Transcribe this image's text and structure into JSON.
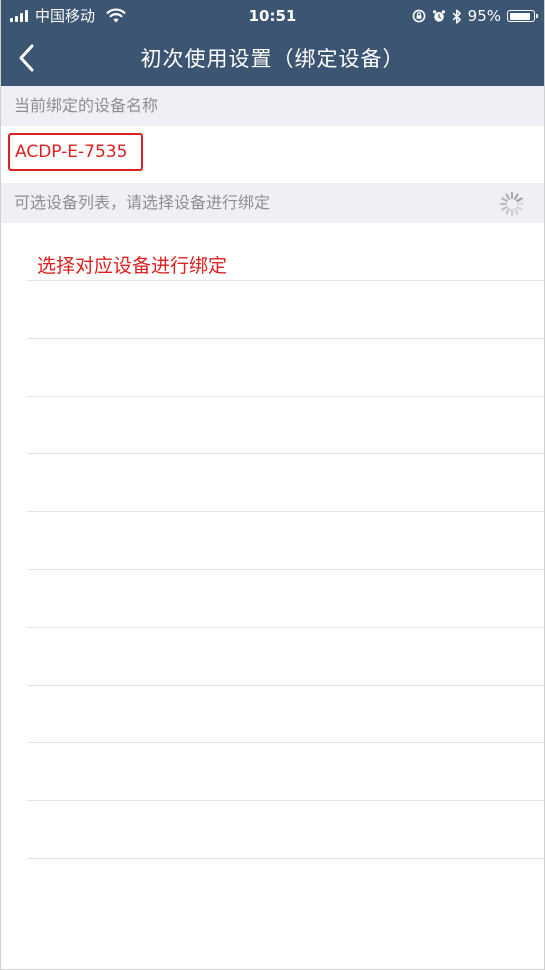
{
  "status_bar": {
    "carrier": "中国移动",
    "time": "10:51",
    "battery_percent": "95%",
    "battery_level": 0.95,
    "icons": [
      "signal-icon",
      "wifi-icon",
      "orientation-lock-icon",
      "alarm-icon",
      "bluetooth-icon",
      "battery-icon"
    ]
  },
  "nav": {
    "title": "初次使用设置（绑定设备）",
    "back_icon": "chevron-left-icon"
  },
  "sections": {
    "current_header": "当前绑定的设备名称",
    "current_device": "ACDP-E-7535",
    "available_header": "可选设备列表，请选择设备进行绑定",
    "loading_icon": "spinner-icon"
  },
  "list": {
    "hint": "选择对应设备进行绑定",
    "rows": [
      0,
      1,
      2,
      3,
      4,
      5,
      6,
      7,
      8,
      9,
      10
    ]
  },
  "colors": {
    "header_bg": "#3c5573",
    "section_bg": "#efeff4",
    "section_text": "#8e8e93",
    "highlight_red": "#e02020"
  }
}
